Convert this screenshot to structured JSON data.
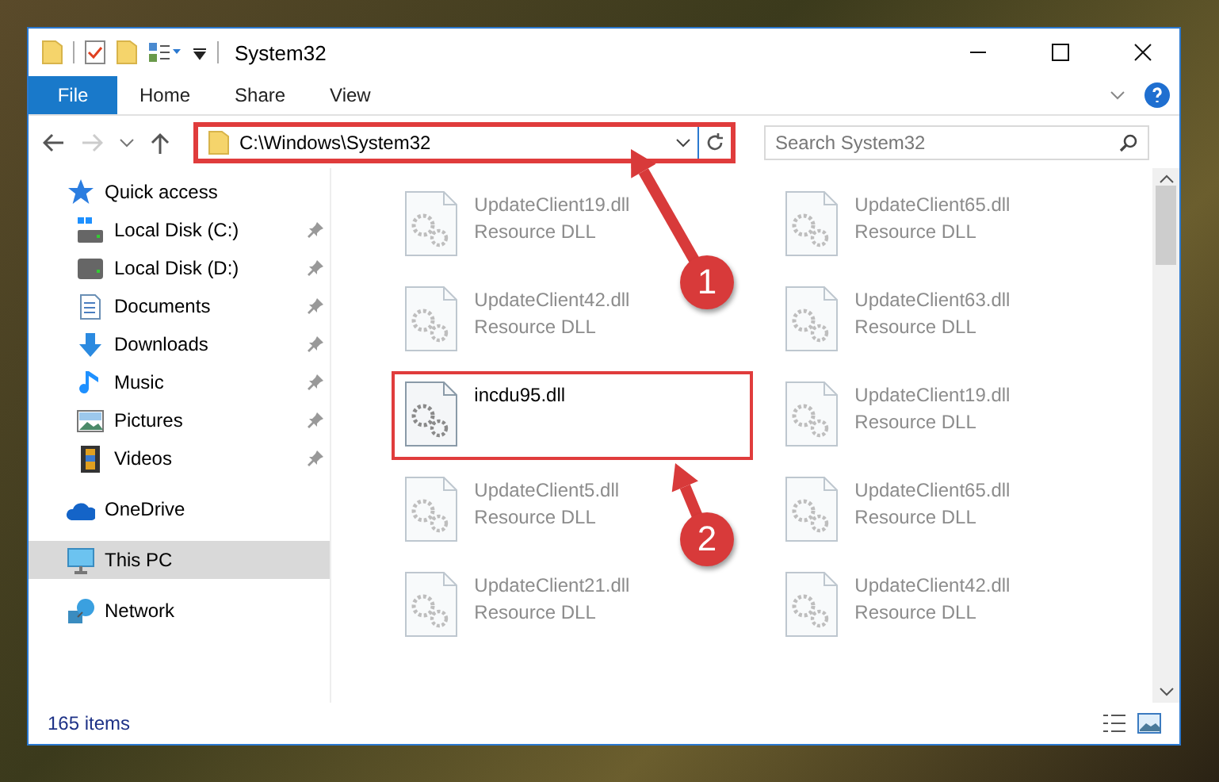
{
  "window": {
    "title": "System32"
  },
  "ribbon": {
    "tabs": [
      {
        "label": "File",
        "selected": true
      },
      {
        "label": "Home",
        "selected": false
      },
      {
        "label": "Share",
        "selected": false
      },
      {
        "label": "View",
        "selected": false
      }
    ]
  },
  "address": {
    "path": "C:\\Windows\\System32",
    "highlighted": true
  },
  "search": {
    "placeholder": "Search System32"
  },
  "sidebar": {
    "items": [
      {
        "label": "Quick access",
        "selected": false,
        "children": [
          {
            "label": "Local Disk (C:)",
            "pinned": true
          },
          {
            "label": "Local Disk (D:)",
            "pinned": true
          },
          {
            "label": "Documents",
            "pinned": true
          },
          {
            "label": "Downloads",
            "pinned": true
          },
          {
            "label": "Music",
            "pinned": true
          },
          {
            "label": "Pictures",
            "pinned": true
          },
          {
            "label": "Videos",
            "pinned": true
          }
        ]
      },
      {
        "label": "OneDrive",
        "selected": false
      },
      {
        "label": "This PC",
        "selected": true
      },
      {
        "label": "Network",
        "selected": false
      }
    ]
  },
  "files": [
    {
      "name": "UpdateClient19.dll",
      "type": "Resource DLL",
      "highlighted": false
    },
    {
      "name": "UpdateClient65.dll",
      "type": "Resource DLL",
      "highlighted": false
    },
    {
      "name": "UpdateClient42.dll",
      "type": "Resource DLL",
      "highlighted": false
    },
    {
      "name": "UpdateClient63.dll",
      "type": "Resource DLL",
      "highlighted": false
    },
    {
      "name": "incdu95.dll",
      "highlighted": true
    },
    {
      "name": "UpdateClient19.dll",
      "type": "Resource DLL",
      "highlighted": false
    },
    {
      "name": "UpdateClient5.dll",
      "type": "Resource DLL",
      "highlighted": false
    },
    {
      "name": "UpdateClient65.dll",
      "type": "Resource DLL",
      "highlighted": false
    },
    {
      "name": "UpdateClient21.dll",
      "type": "Resource DLL",
      "highlighted": false
    },
    {
      "name": "UpdateClient42.dll",
      "type": "Resource DLL",
      "highlighted": false
    }
  ],
  "status_bar": {
    "item_count": "165 items"
  },
  "annotations": [
    {
      "label": "1"
    },
    {
      "label": "2"
    }
  ]
}
